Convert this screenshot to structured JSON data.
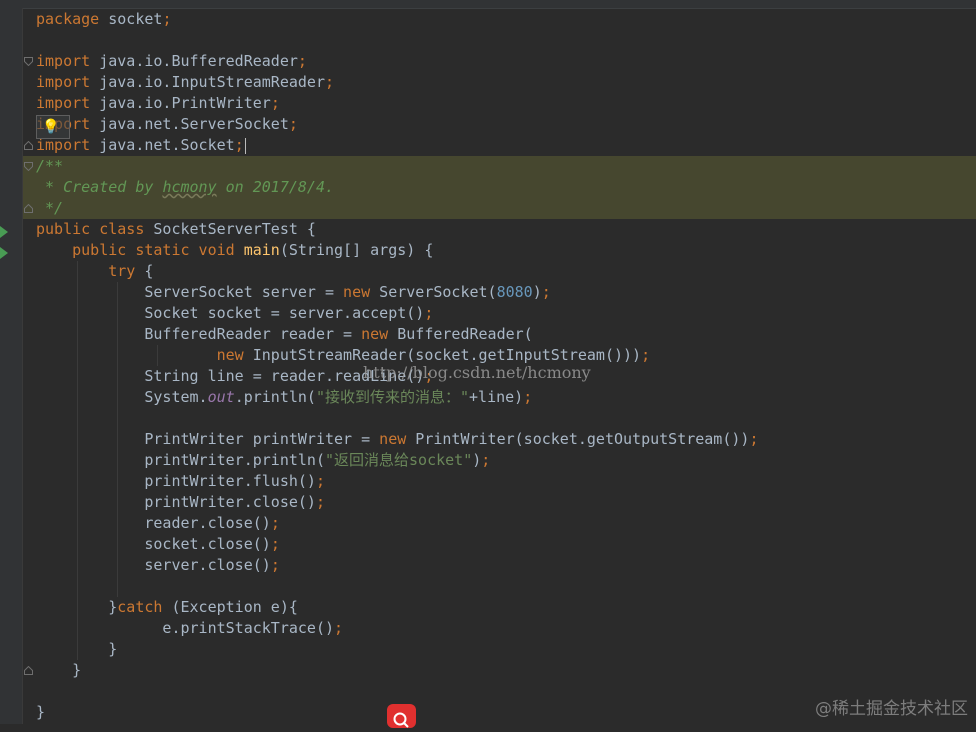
{
  "editor": {
    "lines": [
      [
        {
          "t": "package",
          "c": "kw"
        },
        {
          "t": " socket"
        },
        {
          "t": ";",
          "c": "kw"
        }
      ],
      [],
      [
        {
          "t": "import",
          "c": "kw"
        },
        {
          "t": " java.io.BufferedReader"
        },
        {
          "t": ";",
          "c": "kw"
        }
      ],
      [
        {
          "t": "import",
          "c": "kw"
        },
        {
          "t": " java.io.InputStreamReader"
        },
        {
          "t": ";",
          "c": "kw"
        }
      ],
      [
        {
          "t": "import",
          "c": "kw"
        },
        {
          "t": " java.io.PrintWriter"
        },
        {
          "t": ";",
          "c": "kw"
        }
      ],
      [
        {
          "t": "import",
          "c": "kw"
        },
        {
          "t": " java.net.ServerSocket"
        },
        {
          "t": ";",
          "c": "kw"
        }
      ],
      [
        {
          "t": "import",
          "c": "kw"
        },
        {
          "t": " java.net.Socket"
        },
        {
          "t": ";",
          "c": "kw"
        },
        {
          "t": "",
          "c": "caret"
        }
      ],
      [
        {
          "t": "/**",
          "c": "doc"
        }
      ],
      [
        {
          "t": " * Created by ",
          "c": "doc"
        },
        {
          "t": "hcmony",
          "c": "doc squig"
        },
        {
          "t": " on 2017/8/4.",
          "c": "doc"
        }
      ],
      [
        {
          "t": " */",
          "c": "doc"
        }
      ],
      [
        {
          "t": "public class",
          "c": "kw"
        },
        {
          "t": " SocketServerTest {"
        }
      ],
      [
        {
          "t": "    "
        },
        {
          "t": "public static void",
          "c": "kw"
        },
        {
          "t": " "
        },
        {
          "t": "main",
          "c": "fn"
        },
        {
          "t": "(String[] args) {"
        }
      ],
      [
        {
          "t": "        "
        },
        {
          "t": "try",
          "c": "kw"
        },
        {
          "t": " {"
        }
      ],
      [
        {
          "t": "            ServerSocket server = "
        },
        {
          "t": "new",
          "c": "kw"
        },
        {
          "t": " ServerSocket("
        },
        {
          "t": "8080",
          "c": "num"
        },
        {
          "t": ")"
        },
        {
          "t": ";",
          "c": "kw"
        }
      ],
      [
        {
          "t": "            Socket socket = server.accept()"
        },
        {
          "t": ";",
          "c": "kw"
        }
      ],
      [
        {
          "t": "            BufferedReader reader = "
        },
        {
          "t": "new",
          "c": "kw"
        },
        {
          "t": " BufferedReader("
        }
      ],
      [
        {
          "t": "                    "
        },
        {
          "t": "new",
          "c": "kw"
        },
        {
          "t": " InputStreamReader(socket.getInputStream()))"
        },
        {
          "t": ";",
          "c": "kw"
        }
      ],
      [
        {
          "t": "            String line = reader.readLine()"
        },
        {
          "t": ";",
          "c": "kw"
        }
      ],
      [
        {
          "t": "            System."
        },
        {
          "t": "out",
          "c": "fld"
        },
        {
          "t": ".println("
        },
        {
          "t": "\"接收到传来的消息：\"",
          "c": "str"
        },
        {
          "t": "+line)"
        },
        {
          "t": ";",
          "c": "kw"
        }
      ],
      [],
      [
        {
          "t": "            PrintWriter printWriter = "
        },
        {
          "t": "new",
          "c": "kw"
        },
        {
          "t": " PrintWriter(socket.getOutputStream())"
        },
        {
          "t": ";",
          "c": "kw"
        }
      ],
      [
        {
          "t": "            printWriter.println("
        },
        {
          "t": "\"返回消息给socket\"",
          "c": "str"
        },
        {
          "t": ")"
        },
        {
          "t": ";",
          "c": "kw"
        }
      ],
      [
        {
          "t": "            printWriter.flush()"
        },
        {
          "t": ";",
          "c": "kw"
        }
      ],
      [
        {
          "t": "            printWriter.close()"
        },
        {
          "t": ";",
          "c": "kw"
        }
      ],
      [
        {
          "t": "            reader.close()"
        },
        {
          "t": ";",
          "c": "kw"
        }
      ],
      [
        {
          "t": "            socket.close()"
        },
        {
          "t": ";",
          "c": "kw"
        }
      ],
      [
        {
          "t": "            server.close()"
        },
        {
          "t": ";",
          "c": "kw"
        }
      ],
      [],
      [
        {
          "t": "        }"
        },
        {
          "t": "catch",
          "c": "kw"
        },
        {
          "t": " (Exception e){"
        }
      ],
      [
        {
          "t": "              e.printStackTrace()"
        },
        {
          "t": ";",
          "c": "kw"
        }
      ],
      [
        {
          "t": "        }"
        }
      ],
      [
        {
          "t": "    }"
        }
      ],
      [],
      [
        {
          "t": "}"
        }
      ]
    ]
  },
  "overlays": {
    "watermark": "http://blog.csdn.net/hcmony",
    "brand": "@稀土掘金技术社区"
  }
}
